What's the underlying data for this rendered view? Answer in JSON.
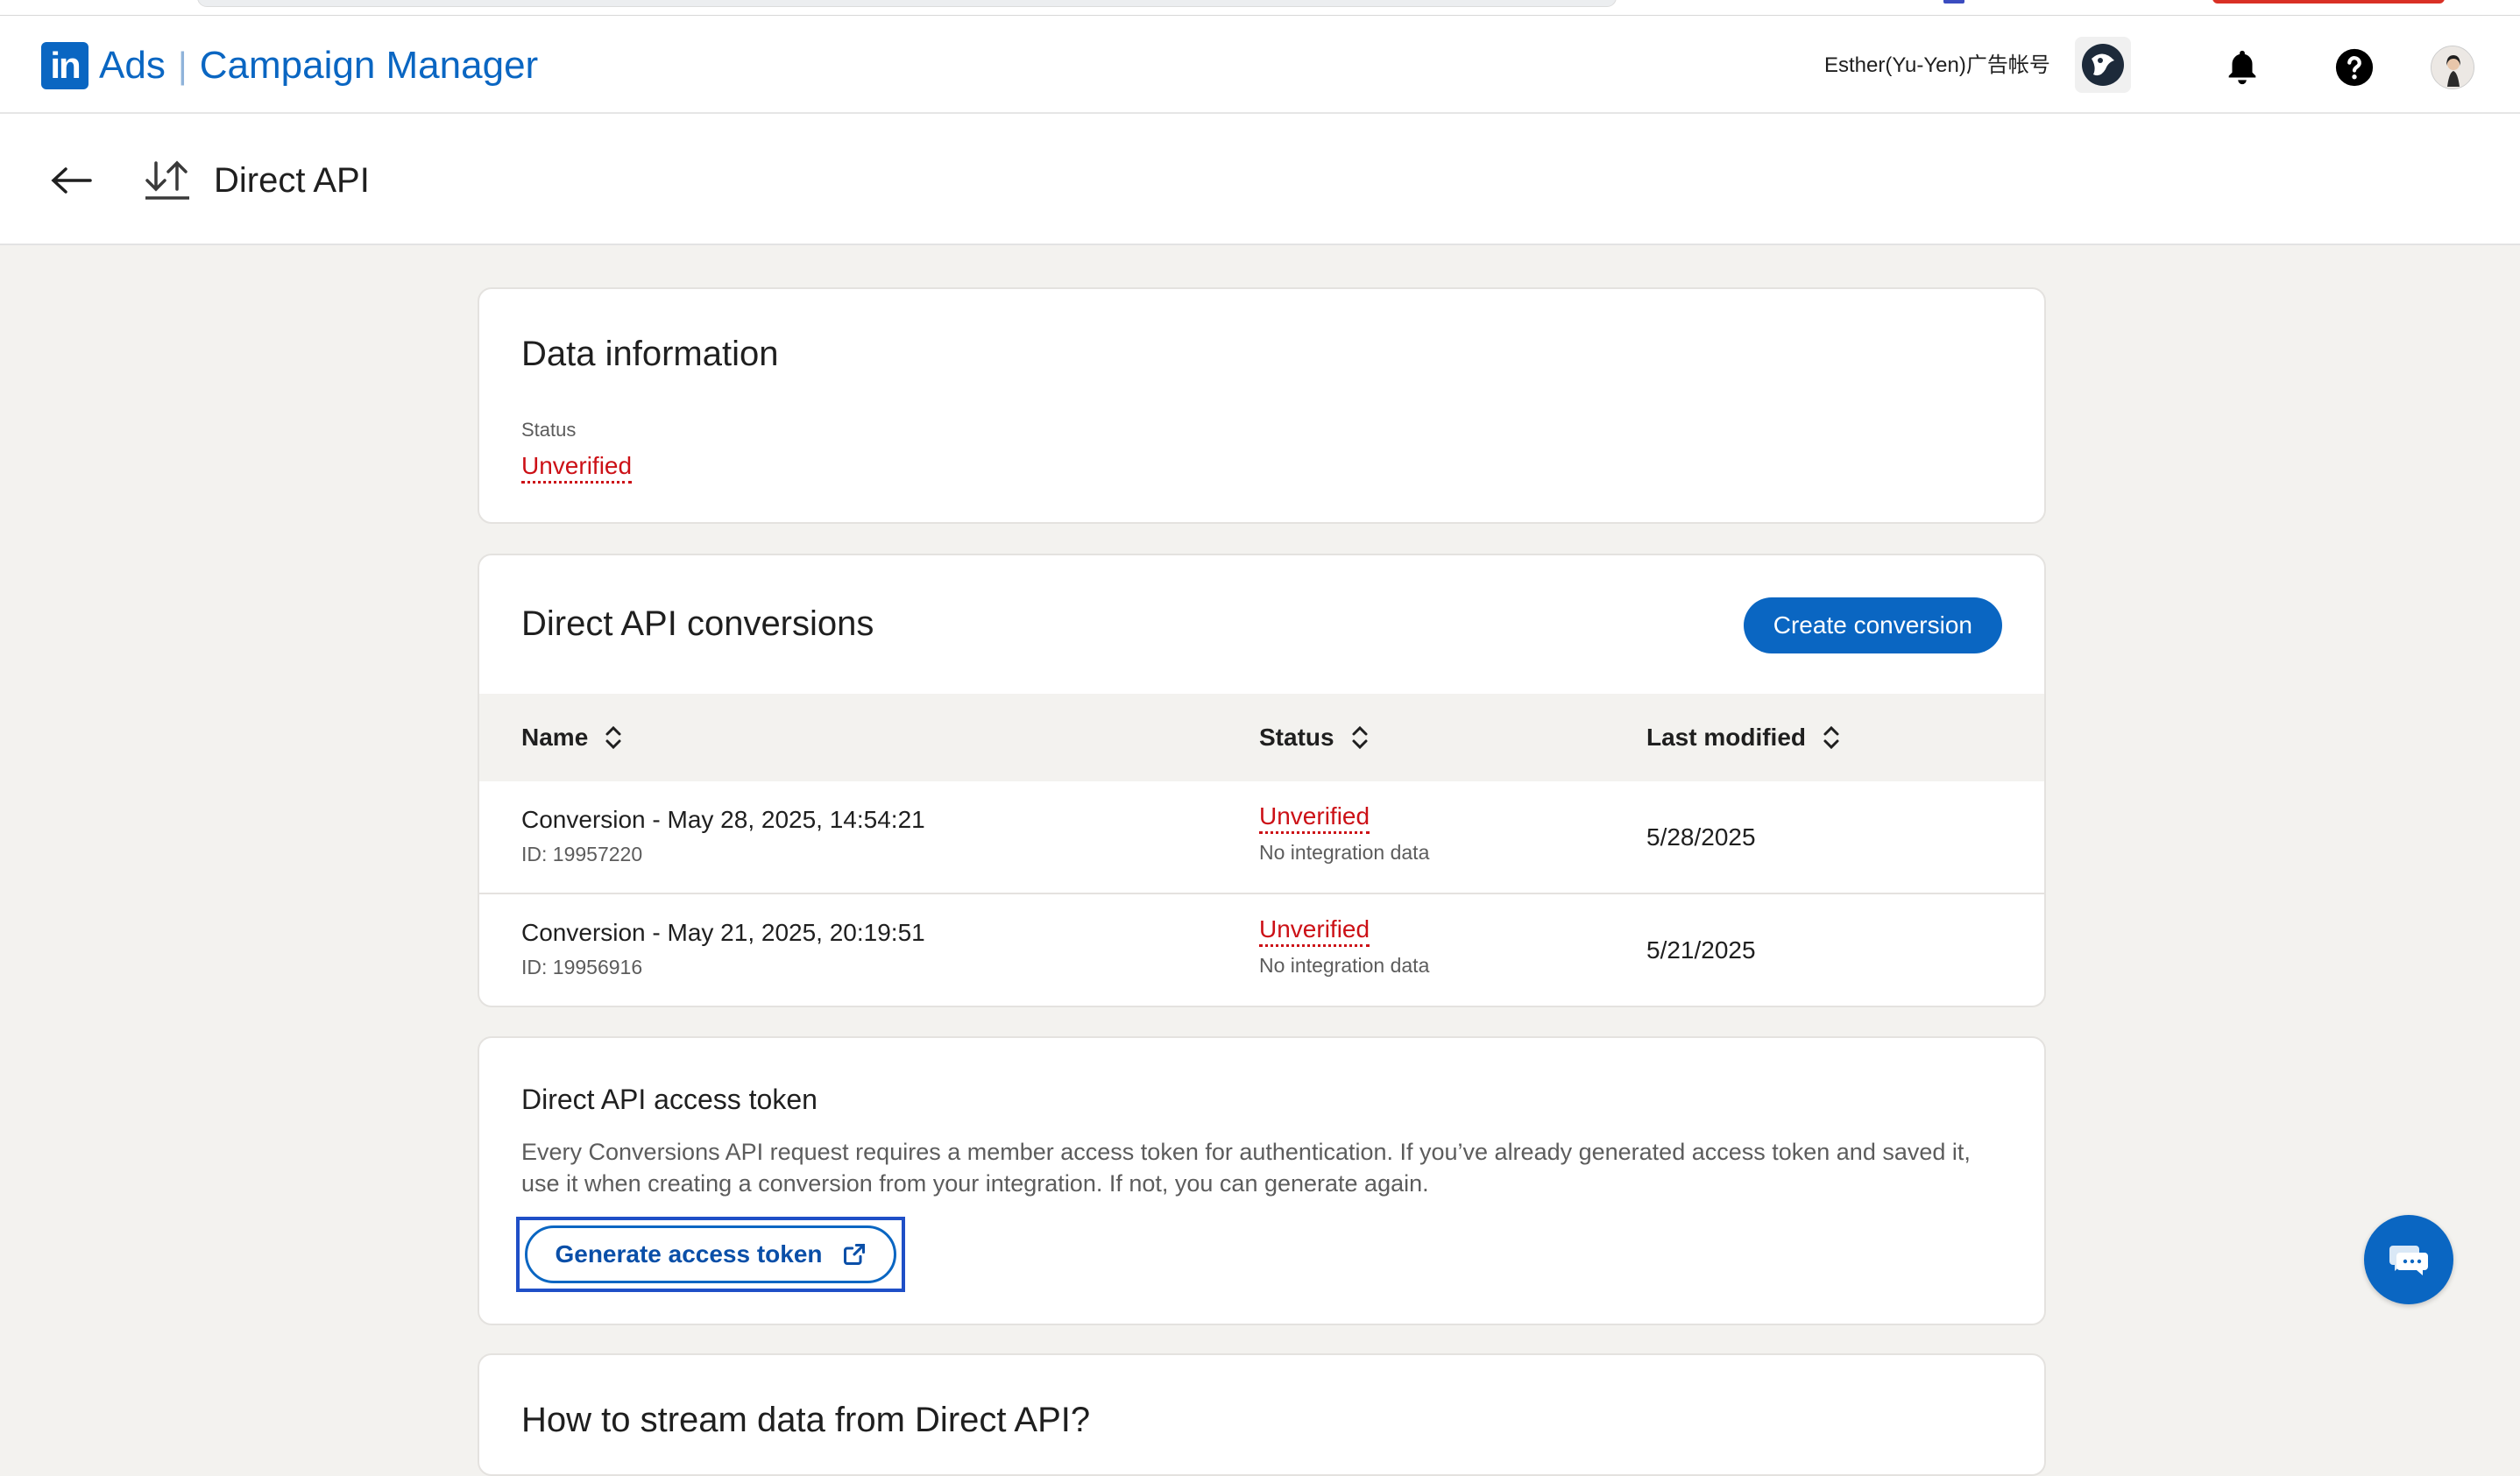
{
  "header": {
    "logo_text": "in",
    "brand_ads": "Ads",
    "brand_separator": "|",
    "brand_app": "Campaign Manager",
    "account_name": "Esther(Yu-Yen)广告帐号",
    "icons": [
      "account-avatar-icon",
      "bell-icon",
      "help-icon",
      "profile-icon"
    ]
  },
  "subheader": {
    "title": "Direct API",
    "back_icon": "arrow-left-icon",
    "page_icon": "upload-download-icon"
  },
  "data_info": {
    "title": "Data information",
    "status_label": "Status",
    "status_value": "Unverified"
  },
  "conversions": {
    "title": "Direct API conversions",
    "create_button": "Create conversion",
    "columns": [
      "Name",
      "Status",
      "Last modified"
    ],
    "rows": [
      {
        "name": "Conversion - May 28, 2025, 14:54:21",
        "id": "ID: 19957220",
        "status": "Unverified",
        "status_sub": "No integration data",
        "last_modified": "5/28/2025"
      },
      {
        "name": "Conversion - May 21, 2025, 20:19:51",
        "id": "ID: 19956916",
        "status": "Unverified",
        "status_sub": "No integration data",
        "last_modified": "5/21/2025"
      }
    ]
  },
  "token": {
    "title": "Direct API access token",
    "description": "Every Conversions API request requires a member access token for authentication. If you’ve already generated access token and saved it, use it when creating a conversion from your integration. If not, you can generate again.",
    "button": "Generate access token"
  },
  "stream": {
    "title": "How to stream data from Direct API?"
  },
  "colors": {
    "brand_blue": "#0a66c2",
    "error_red": "#cc1016",
    "page_bg": "#f3f2ef"
  }
}
